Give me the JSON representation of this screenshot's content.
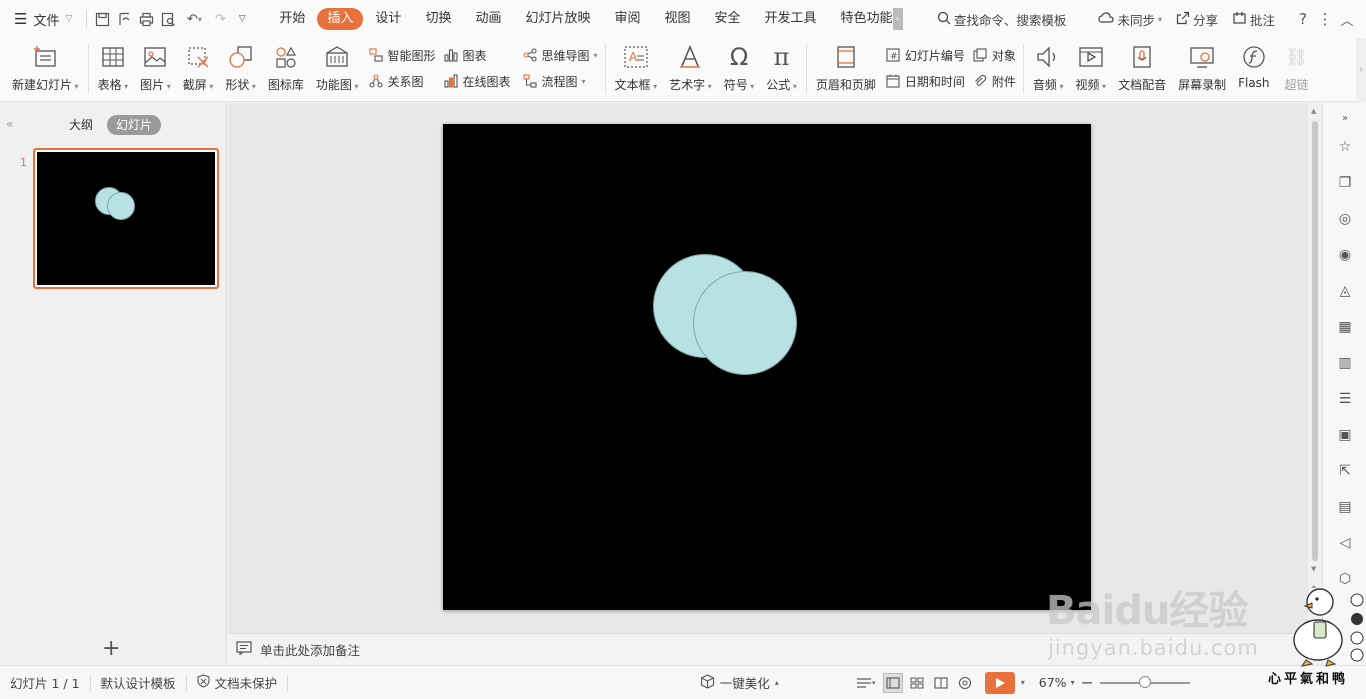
{
  "menubar": {
    "file_label": "文件",
    "tabs": [
      "开始",
      "插入",
      "设计",
      "切换",
      "动画",
      "幻灯片放映",
      "审阅",
      "视图",
      "安全",
      "开发工具",
      "特色功能"
    ],
    "active_tab": "插入",
    "search_placeholder": "查找命令、搜索模板",
    "sync_label": "未同步",
    "share_label": "分享",
    "comment_label": "批注"
  },
  "ribbon": {
    "new_slide": "新建幻灯片",
    "table": "表格",
    "picture": "图片",
    "screenshot": "截屏",
    "shape": "形状",
    "icon_lib": "图标库",
    "function_chart": "功能图",
    "smart_art": "智能图形",
    "chart": "图表",
    "relation": "关系图",
    "online_chart": "在线图表",
    "mindmap": "思维导图",
    "flowchart": "流程图",
    "textbox": "文本框",
    "wordart": "艺术字",
    "symbol": "符号",
    "formula": "公式",
    "header_footer": "页眉和页脚",
    "slide_number": "幻灯片编号",
    "object": "对象",
    "datetime": "日期和时间",
    "attachment": "附件",
    "audio": "音频",
    "video": "视频",
    "doc_voice": "文档配音",
    "screen_record": "屏幕录制",
    "flash": "Flash",
    "hyperlink": "超链"
  },
  "leftpanel": {
    "outline_tab": "大纲",
    "slides_tab": "幻灯片",
    "slide_number": "1"
  },
  "notes": {
    "placeholder": "单击此处添加备注"
  },
  "statusbar": {
    "slide_info": "幻灯片 1 / 1",
    "template": "默认设计模板",
    "protection": "文档未保护",
    "beautify": "一键美化",
    "zoom": "67%",
    "zoom_fraction": 0.5
  },
  "watermark": {
    "logo_text": "Baidu经验",
    "url": "jingyan.baidu.com",
    "mascot_caption": "心平氣和鸭"
  },
  "colors": {
    "accent": "#e8713c",
    "slide_bg": "#000000",
    "circle_fill": "#b9e0e3",
    "circle_stroke": "#7fa8ab"
  }
}
